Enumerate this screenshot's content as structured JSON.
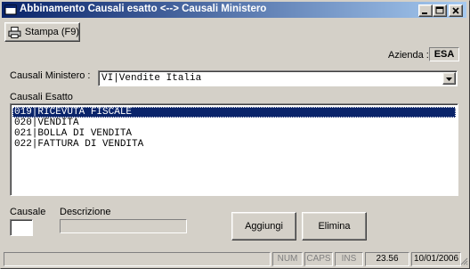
{
  "window": {
    "title": "Abbinamento Causali esatto  <-->  Causali Ministero"
  },
  "toolbar": {
    "print_label": "Stampa (F9)"
  },
  "azienda": {
    "label": "Azienda :",
    "value": "ESA"
  },
  "causali_ministero": {
    "label": "Causali Ministero :",
    "value": "VI|Vendite Italia"
  },
  "causali_esatto": {
    "label": "Causali Esatto",
    "items": [
      "019|RICEVUTA FISCALE",
      "020|VENDITA",
      "021|BOLLA DI VENDITA",
      "022|FATTURA DI VENDITA"
    ],
    "selected_index": 0
  },
  "form": {
    "causale_label": "Causale",
    "causale_value": "",
    "descrizione_label": "Descrizione",
    "descrizione_value": ""
  },
  "buttons": {
    "add_label": "Aggiungi",
    "delete_label": "Elimina"
  },
  "statusbar": {
    "num": "NUM",
    "caps": "CAPS",
    "ins": "INS",
    "time": "23.56",
    "date": "10/01/2006"
  },
  "icons": {
    "window": "app-icon",
    "print": "printer-icon",
    "dropdown": "chevron-down-icon"
  }
}
